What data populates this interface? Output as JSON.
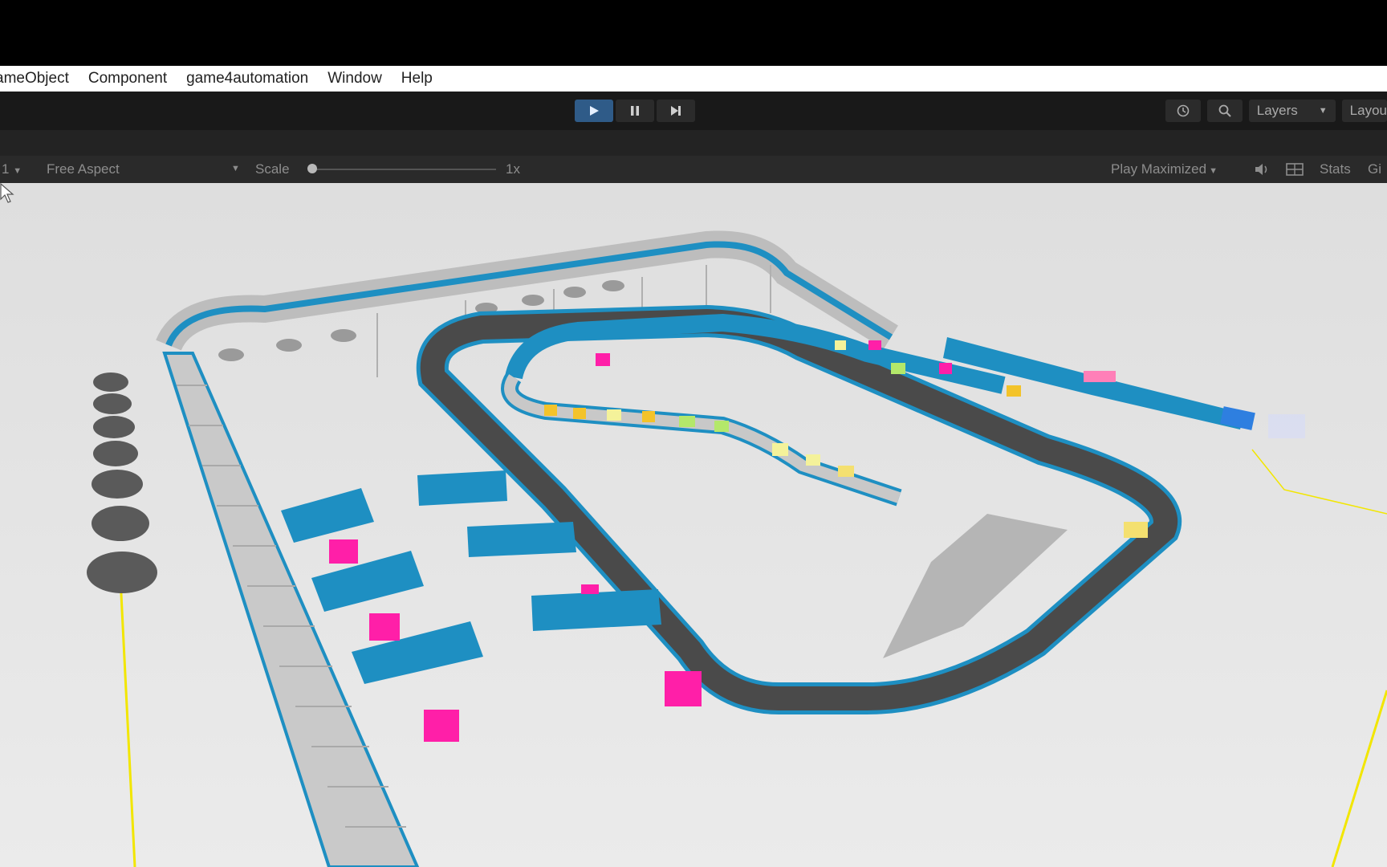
{
  "menu": {
    "items": [
      "ameObject",
      "Component",
      "game4automation",
      "Window",
      "Help"
    ]
  },
  "toolbar": {
    "play_icon": "play-icon",
    "pause_icon": "pause-icon",
    "step_icon": "step-icon",
    "history_icon": "history-icon",
    "search_icon": "search-icon",
    "layers_label": "Layers",
    "layout_label": "Layou"
  },
  "game_view": {
    "display_label": "1",
    "aspect_label": "Free Aspect",
    "scale_label": "Scale",
    "scale_value": "1x",
    "play_mode_label": "Play Maximized",
    "audio_icon": "speaker-icon",
    "gizmo_icon": "grid-icon",
    "stats_label": "Stats",
    "gizmos_label": "Gi"
  },
  "colors": {
    "conveyor_blue": "#1e8fc2",
    "belt_dark": "#4a4a4a",
    "box_magenta": "#ff1fa8",
    "floor": "#e6e6e6",
    "guide_yellow": "#f2e600"
  }
}
